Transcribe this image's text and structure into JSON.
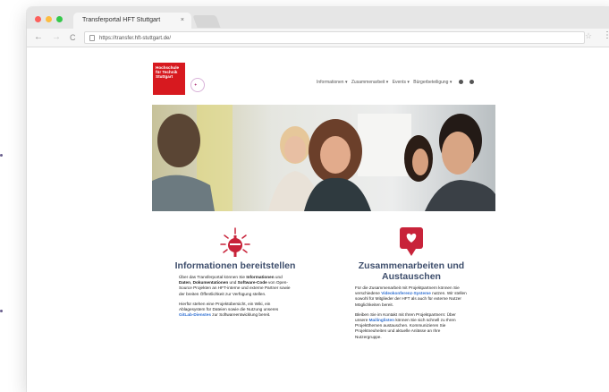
{
  "browser": {
    "tab_title": "Transferportal HFT Stuttgart",
    "tab_close": "×",
    "url": "https://transfer.hft-stuttgart.de/",
    "back": "←",
    "forward": "→",
    "reload": "C",
    "star": "☆",
    "menu": "⋮"
  },
  "site": {
    "logo_text": "Hochschule für Technik Stuttgart",
    "nav": [
      "Informationen ▾",
      "Zusammenarbeit ▾",
      "Events ▾",
      "Bürgerbeteiligung ▾"
    ]
  },
  "features": [
    {
      "icon": "tv-tower-light-icon",
      "title": "Informationen bereitstellen",
      "p1_a": "Über das Transferportal können Sie ",
      "p1_b": "Informationen",
      "p1_c": " und ",
      "p1_d": "Daten",
      "p1_e": ", ",
      "p1_f": "Dokumentationen",
      "p1_g": " und ",
      "p1_h": "Software-Code",
      "p1_i": " von Open-Source Projekten an HFT-interne und externe Partner sowie der breiten Öffentlichkeit zur Verfügung stellen.",
      "p2_a": "Hierfür stehen eine Projektübersicht, ein Wiki, ein Ablagesystem für Dateien sowie die Nutzung unseres ",
      "p2_link": "GitLab-Dienstes",
      "p2_b": " zur Softwareentwicklung bereit."
    },
    {
      "icon": "heart-chat-icon",
      "title": "Zusammenarbeiten und Austauschen",
      "p1_a": "Für die Zusammenarbeit mit Projektpartnern können Sie verschiedene ",
      "p1_link": "Videokonferenz-Systeme",
      "p1_b": " nutzen. Wir stellen sowohl für Mitglieder der HFT als auch für externe Nutzer Möglichkeiten bereit.",
      "p2_a": "Bleiben Sie im Kontakt mit Ihren Projektpartnern: Über unsere ",
      "p2_link": "Mailinglisten",
      "p2_b": " können Sie sich schnell zu Ihren Projektthemen austauschen. Kommunizieren Sie Projektneuheiten und aktuelle Anlässe an Ihre Nutzergruppe."
    }
  ],
  "colors": {
    "brand_red": "#d7191f",
    "heading": "#3e4e6c",
    "icon_red": "#c8233a",
    "link": "#2f6fd1"
  }
}
